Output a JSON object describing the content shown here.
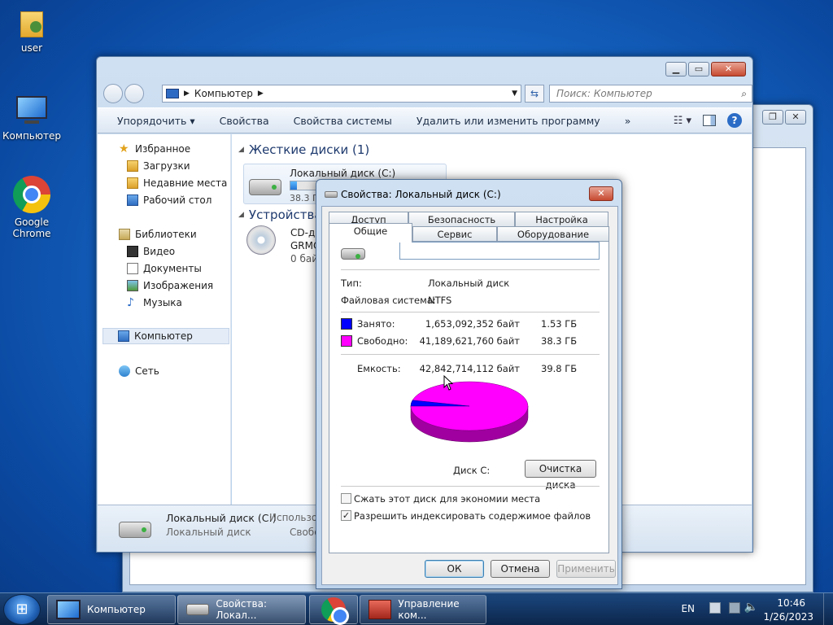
{
  "desktop": {
    "icons": [
      {
        "label": "user"
      },
      {
        "label": "Компьютер"
      },
      {
        "label": "Google Chrome"
      }
    ]
  },
  "explorer": {
    "address_path": "Компьютер",
    "search_placeholder": "Поиск: Компьютер",
    "toolbar": {
      "organize": "Упорядочить",
      "properties": "Свойства",
      "system_properties": "Свойства системы",
      "uninstall": "Удалить или изменить программу",
      "more": "»"
    },
    "sidebar": {
      "favorites": "Избранное",
      "downloads": "Загрузки",
      "recent": "Недавние места",
      "desktop": "Рабочий стол",
      "libraries": "Библиотеки",
      "video": "Видео",
      "documents": "Документы",
      "images": "Изображения",
      "music": "Музыка",
      "computer": "Компьютер",
      "network": "Сеть"
    },
    "content": {
      "hard_drives_header": "Жесткие диски (1)",
      "drive_name": "Локальный диск (C:)",
      "drive_free_short": "38.3 Г",
      "drive_used_fraction": 0.04,
      "devices_header": "Устройства",
      "cd_line1": "CD-ди",
      "cd_line2": "GRMC",
      "cd_line3": "0 бай"
    },
    "details": {
      "name": "Локальный диск (C:)",
      "type": "Локальный диск",
      "used_label": "Использо",
      "free_label": "Свобо"
    }
  },
  "dialog": {
    "title": "Свойства: Локальный диск (C:)",
    "tabs_back": [
      "Доступ",
      "Безопасность",
      "Настройка"
    ],
    "tabs_front": [
      "Общие",
      "Сервис",
      "Оборудование"
    ],
    "label_value": "",
    "type_label": "Тип:",
    "type_value": "Локальный диск",
    "fs_label": "Файловая система:",
    "fs_value": "NTFS",
    "used_label": "Занято:",
    "used_bytes": "1,653,092,352 байт",
    "used_gb": "1.53 ГБ",
    "free_label": "Свободно:",
    "free_bytes": "41,189,621,760 байт",
    "free_gb": "38.3 ГБ",
    "capacity_label": "Емкость:",
    "capacity_bytes": "42,842,714,112 байт",
    "capacity_gb": "39.8 ГБ",
    "used_color": "#0000ff",
    "free_color": "#ff00ff",
    "disk_label": "Диск C:",
    "cleanup_button": "Очистка диска",
    "compress_label": "Сжать этот диск для экономии места",
    "compress_checked": false,
    "index_label": "Разрешить индексировать содержимое файлов",
    "index_checked": true,
    "ok": "ОК",
    "cancel": "Отмена",
    "apply": "Применить"
  },
  "taskbar": {
    "items": [
      {
        "label": "Компьютер"
      },
      {
        "label": "Свойства: Локал..."
      },
      {
        "label": ""
      },
      {
        "label": "Управление ком..."
      }
    ],
    "lang": "EN",
    "time": "10:46",
    "date": "1/26/2023"
  }
}
